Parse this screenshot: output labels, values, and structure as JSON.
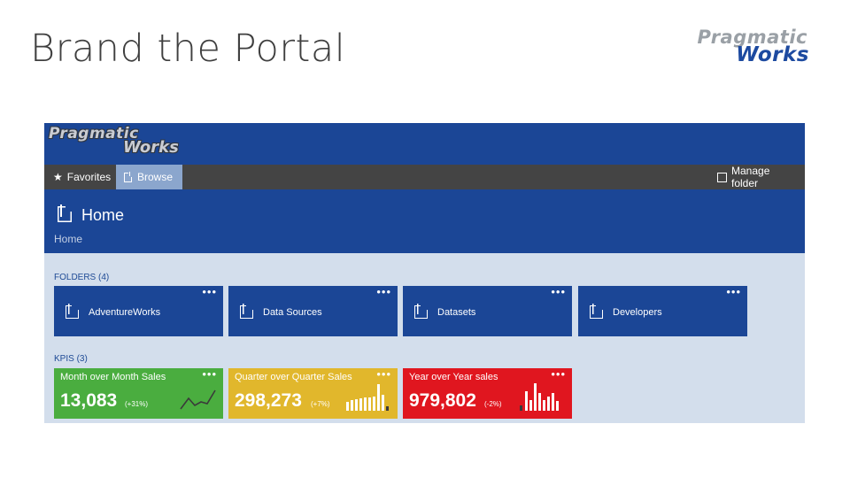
{
  "slide": {
    "title": "Brand the Portal"
  },
  "logo": {
    "line1": "Pragmatic",
    "line2": "Works"
  },
  "portal": {
    "brand_logo": {
      "line1": "Pragmatic",
      "line2": "Works"
    },
    "nav": {
      "favorites": "Favorites",
      "browse": "Browse",
      "manage_folder": "Manage folder"
    },
    "header": {
      "title": "Home",
      "breadcrumb": "Home"
    },
    "folders": {
      "label": "FOLDERS",
      "count": "(4)",
      "items": [
        {
          "name": "AdventureWorks"
        },
        {
          "name": "Data Sources"
        },
        {
          "name": "Datasets"
        },
        {
          "name": "Developers"
        }
      ]
    },
    "kpis": {
      "label": "KPIS",
      "count": "(3)",
      "items": [
        {
          "name": "Month over Month Sales",
          "value": "13,083",
          "change": "(+31%)",
          "color": "#4aad3f",
          "visual": "line"
        },
        {
          "name": "Quarter over Quarter Sales",
          "value": "298,273",
          "change": "(+7%)",
          "color": "#e1b72c",
          "visual": "bars"
        },
        {
          "name": "Year over Year sales",
          "value": "979,802",
          "change": "(-2%)",
          "color": "#e0161f",
          "visual": "bars"
        }
      ]
    },
    "colors": {
      "brand": "#1b4696",
      "nav": "#444444",
      "nav_active": "#8ba6cd",
      "background": "#d3deec"
    },
    "icons": {
      "favorites": "star-icon",
      "browse": "browse-icon",
      "manage": "manage-folder-icon",
      "home": "home-folder-icon",
      "folder": "folder-icon",
      "more": "more-icon"
    }
  }
}
